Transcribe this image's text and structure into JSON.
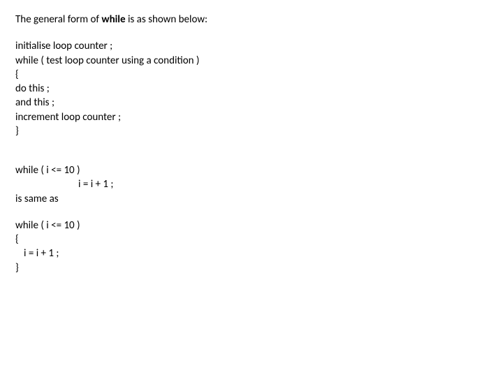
{
  "intro": {
    "prefix": "The general form of ",
    "keyword": "while",
    "suffix": " is as shown below:"
  },
  "pseudo": {
    "l1": "initialise loop counter ;",
    "l2": "while ( test loop counter using a condition )",
    "l3": "{",
    "l4": "do this ;",
    "l5": "and this ;",
    "l6": "increment loop counter ;",
    "l7": "}"
  },
  "ex1": {
    "l1": "while ( i <= 10 )",
    "l2": "i = i + 1 ;",
    "note": "is same as"
  },
  "ex2": {
    "l1": "while ( i <= 10 )",
    "l2": "{",
    "l3": "i = i + 1 ;",
    "l4": "}"
  }
}
